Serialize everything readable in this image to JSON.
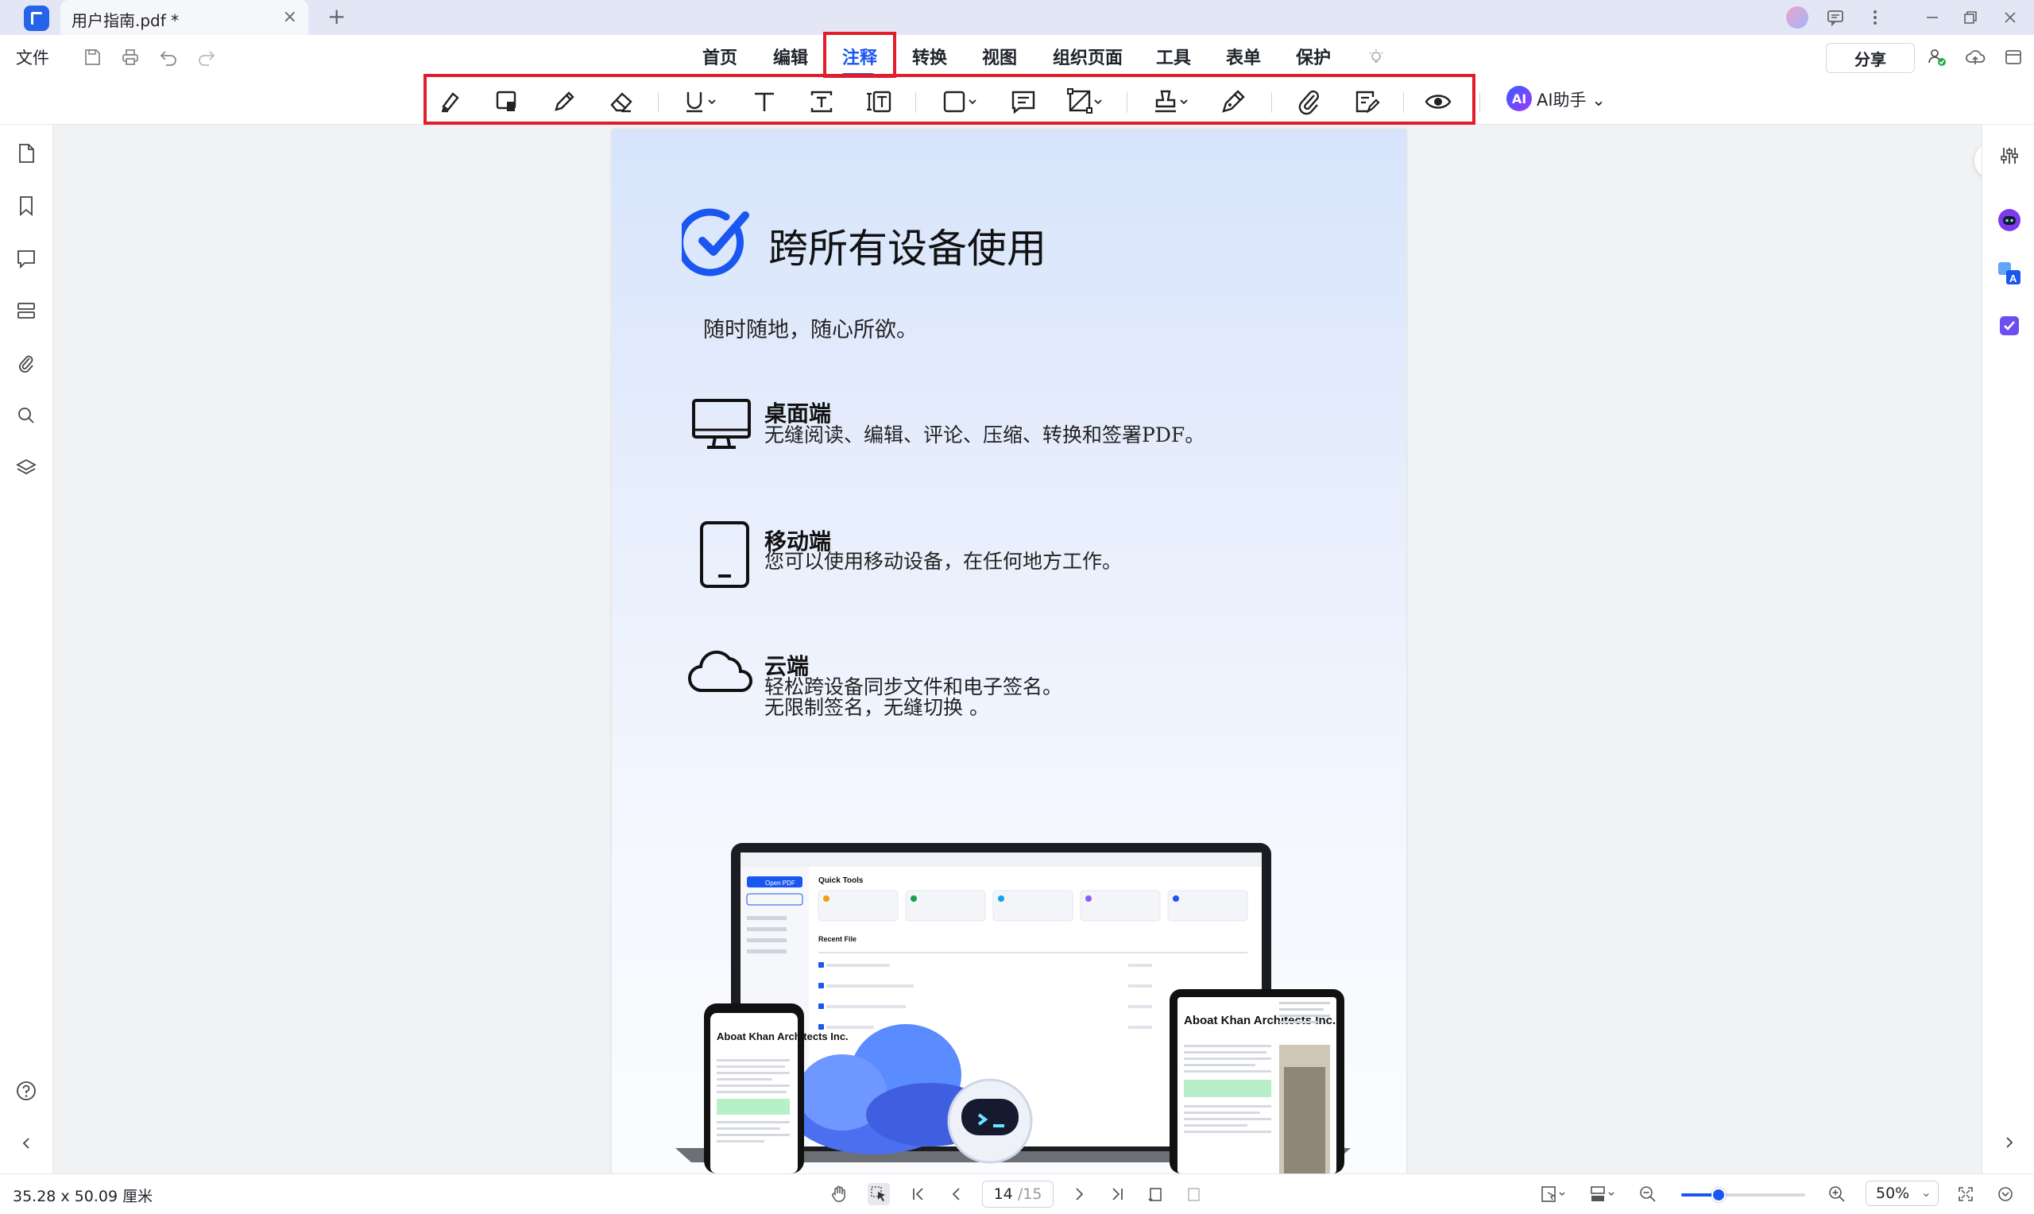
{
  "tabbar": {
    "doc_title": "用户指南.pdf *",
    "close_glyph": "×",
    "new_tab_glyph": "+"
  },
  "menubar": {
    "file_label": "文件",
    "tabs": [
      {
        "label": "首页"
      },
      {
        "label": "编辑"
      },
      {
        "label": "注释",
        "active": true
      },
      {
        "label": "转换"
      },
      {
        "label": "视图"
      },
      {
        "label": "组织页面"
      },
      {
        "label": "工具"
      },
      {
        "label": "表单"
      },
      {
        "label": "保护"
      }
    ],
    "share_label": "分享"
  },
  "toolbar": {
    "tools": [
      "highlight-icon",
      "area-highlight-icon",
      "pencil-icon",
      "eraser-icon",
      "underline-icon",
      "text-icon",
      "textbox-icon",
      "callout-icon",
      "shape-icon",
      "note-icon",
      "measure-icon",
      "stamp-icon",
      "signature-icon",
      "attachment-icon",
      "sticky-list-icon",
      "eye-icon"
    ],
    "ai_badge": "AI",
    "ai_label": "AI助手"
  },
  "document": {
    "title": "跨所有设备使用",
    "subtitle": "随时随地，随心所欲。",
    "features": [
      {
        "title": "桌面端",
        "lines": [
          "无缝阅读、编辑、评论、压缩、转换和签署PDF。"
        ]
      },
      {
        "title": "移动端",
        "lines": [
          "您可以使用移动设备，在任何地方工作。"
        ]
      },
      {
        "title": "云端",
        "lines": [
          "轻松跨设备同步文件和电子签名。",
          "无限制签名，无缝切换 。"
        ]
      }
    ],
    "mockup": {
      "quick_tools": "Quick Tools",
      "recent_file": "Recent File",
      "open_pdf": "Open PDF",
      "phone_heading": "Aboat Khan Architects Inc.",
      "tablet_heading": "Aboat Khan Architects Inc."
    }
  },
  "statusbar": {
    "dimensions": "35.28 x 50.09 厘米",
    "current_page": "14",
    "total_pages": "/15",
    "zoom": "50%",
    "zoom_fraction": 0.3
  },
  "colors": {
    "accent": "#1a56f0",
    "highlight_box": "#e11d2c"
  }
}
